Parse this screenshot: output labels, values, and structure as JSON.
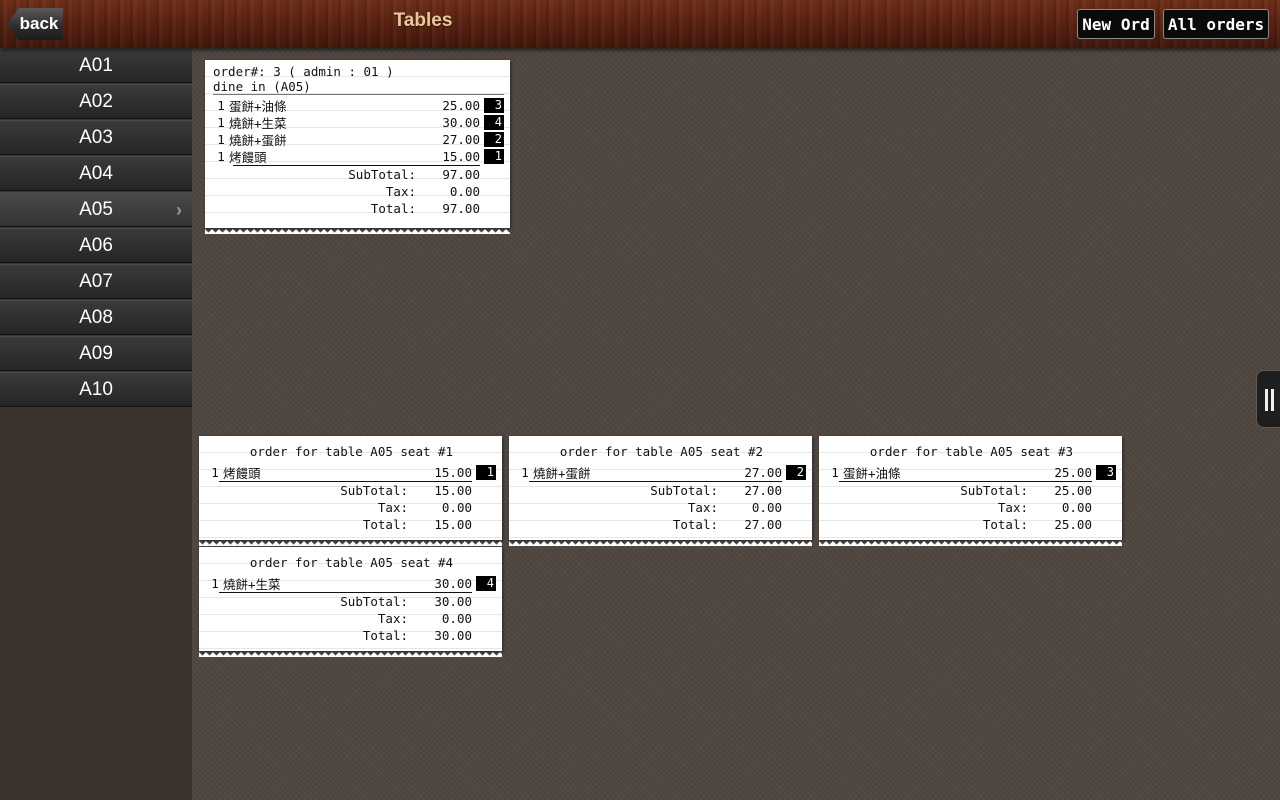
{
  "header": {
    "back_label": "back",
    "title": "Tables",
    "new_order_label": "New Ord",
    "all_orders_label": "All orders"
  },
  "sidebar": {
    "items": [
      "A01",
      "A02",
      "A03",
      "A04",
      "A05",
      "A06",
      "A07",
      "A08",
      "A09",
      "A10"
    ],
    "active": "A05"
  },
  "labels": {
    "subtotal": "SubTotal:",
    "tax": "Tax:",
    "total": "Total:"
  },
  "main_order": {
    "header": "order#: 3 ( admin : 01 )",
    "sub": "dine in (A05)",
    "items": [
      {
        "qty": "1",
        "name": "蛋餅+油條",
        "price": "25.00",
        "seat": "3"
      },
      {
        "qty": "1",
        "name": "燒餅+生菜",
        "price": "30.00",
        "seat": "4"
      },
      {
        "qty": "1",
        "name": "燒餅+蛋餅",
        "price": "27.00",
        "seat": "2"
      },
      {
        "qty": "1",
        "name": "烤饅頭",
        "price": "15.00",
        "seat": "1"
      }
    ],
    "subtotal": "97.00",
    "tax": "0.00",
    "total": "97.00"
  },
  "seat_orders": [
    {
      "title": "order for table A05 seat #1",
      "items": [
        {
          "qty": "1",
          "name": "烤饅頭",
          "price": "15.00",
          "seat": "1"
        }
      ],
      "subtotal": "15.00",
      "tax": "0.00",
      "total": "15.00"
    },
    {
      "title": "order for table A05 seat #2",
      "items": [
        {
          "qty": "1",
          "name": "燒餅+蛋餅",
          "price": "27.00",
          "seat": "2"
        }
      ],
      "subtotal": "27.00",
      "tax": "0.00",
      "total": "27.00"
    },
    {
      "title": "order for table A05 seat #3",
      "items": [
        {
          "qty": "1",
          "name": "蛋餅+油條",
          "price": "25.00",
          "seat": "3"
        }
      ],
      "subtotal": "25.00",
      "tax": "0.00",
      "total": "25.00"
    },
    {
      "title": "order for table A05 seat #4",
      "items": [
        {
          "qty": "1",
          "name": "燒餅+生菜",
          "price": "30.00",
          "seat": "4"
        }
      ],
      "subtotal": "30.00",
      "tax": "0.00",
      "total": "30.00"
    }
  ]
}
